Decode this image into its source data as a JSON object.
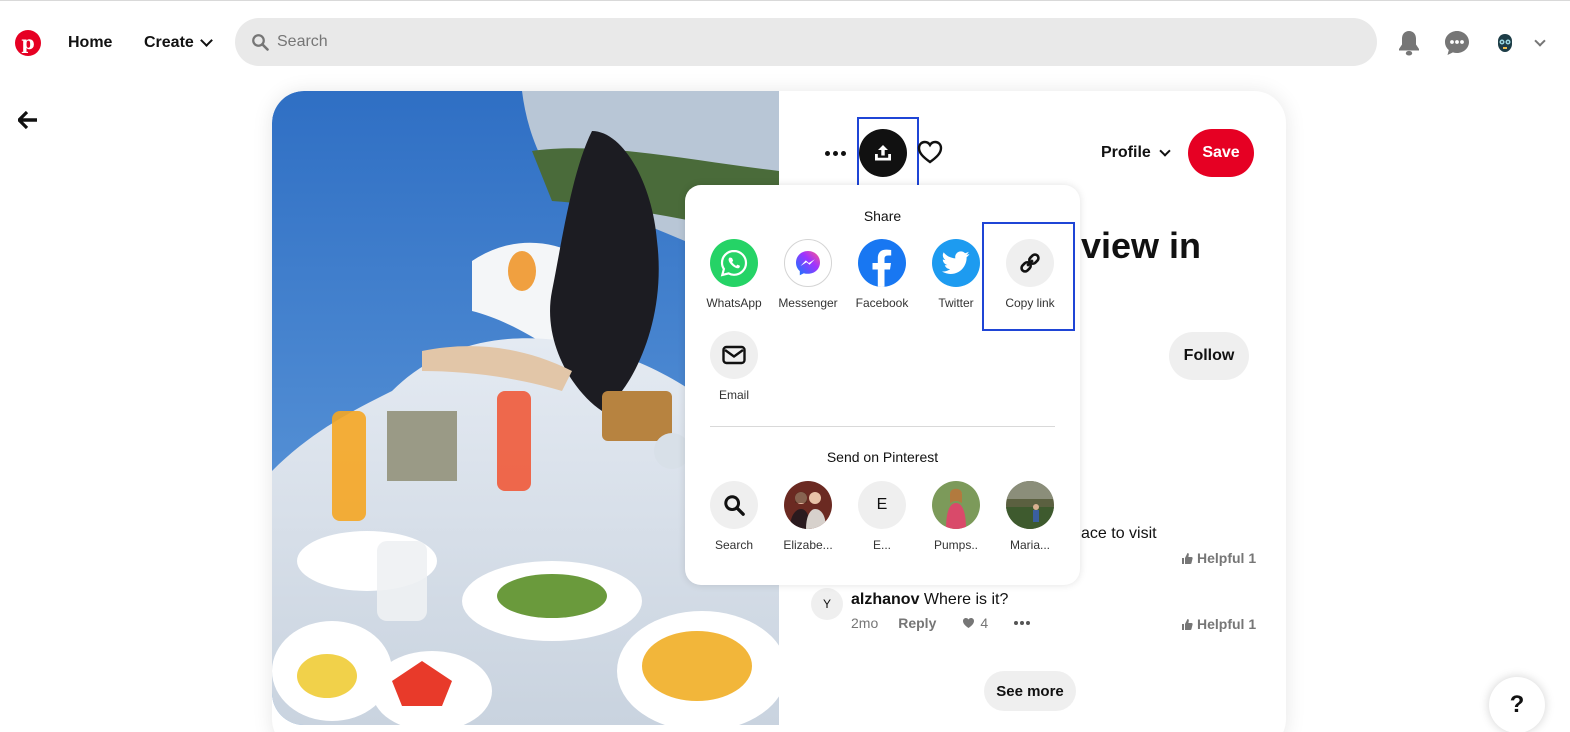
{
  "header": {
    "logo_letter": "p",
    "home_label": "Home",
    "create_label": "Create",
    "search_placeholder": "Search"
  },
  "pin": {
    "title_visible_fragment": "view in",
    "profile_label": "Profile",
    "save_label": "Save",
    "follow_label": "Follow",
    "comments": [
      {
        "text_fragment": "ace to visit",
        "helpful_label": "Helpful 1"
      },
      {
        "avatar_letter": "Y",
        "username": "alzhanov",
        "text": "Where is it?",
        "age": "2mo",
        "reply_label": "Reply",
        "likes": "4",
        "helpful_label": "Helpful 1"
      }
    ],
    "see_more_label": "See more"
  },
  "share_popover": {
    "title": "Share",
    "targets": [
      {
        "label": "WhatsApp",
        "icon": "whatsapp-icon",
        "color": "#25d366"
      },
      {
        "label": "Messenger",
        "icon": "messenger-icon",
        "color": "#0a7cff"
      },
      {
        "label": "Facebook",
        "icon": "facebook-icon",
        "color": "#1877f2"
      },
      {
        "label": "Twitter",
        "icon": "twitter-icon",
        "color": "#1d9bf0"
      },
      {
        "label": "Copy link",
        "icon": "link-icon",
        "color": "#efefef"
      },
      {
        "label": "Email",
        "icon": "email-icon",
        "color": "#efefef"
      }
    ],
    "send_title": "Send on Pinterest",
    "send_targets": [
      {
        "label": "Search",
        "icon": "search-icon"
      },
      {
        "label": "Elizabe...",
        "icon": "avatar-photo"
      },
      {
        "label": "E...",
        "letter": "E"
      },
      {
        "label": "Pumps..",
        "icon": "avatar-photo"
      },
      {
        "label": "Maria...",
        "icon": "avatar-photo"
      }
    ]
  },
  "help_label": "?",
  "colors": {
    "brand_red": "#e60023",
    "highlight_blue": "#1f45d6",
    "search_bg": "#e9e9e9"
  }
}
